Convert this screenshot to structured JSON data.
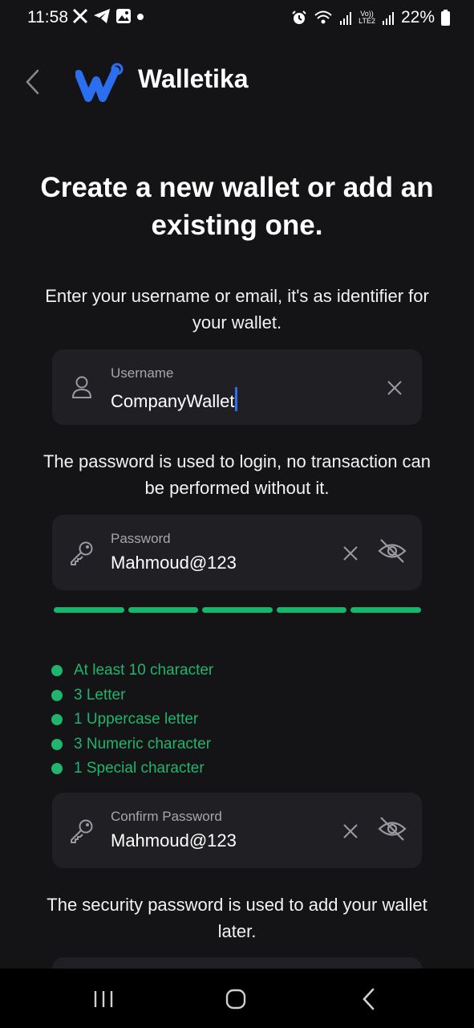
{
  "status_bar": {
    "time": "11:58",
    "net_top": "Vo))",
    "net_bottom": "LTE2",
    "battery": "22%"
  },
  "header": {
    "app_name": "Walletika",
    "brand_color": "#2b6ff0"
  },
  "title": "Create a new wallet or add an existing one.",
  "username_section": {
    "description": "Enter your username or email, it's as identifier for your wallet.",
    "label": "Username",
    "value": "CompanyWallet"
  },
  "password_section": {
    "description": "The password is used to login, no transaction can be performed without it.",
    "label": "Password",
    "value": "Mahmoud@123",
    "strength_segments_filled": 5,
    "strength_color": "#17b66a"
  },
  "password_rules": [
    {
      "text": "At least 10 character",
      "met": true
    },
    {
      "text": "3 Letter",
      "met": true
    },
    {
      "text": "1 Uppercase letter",
      "met": true
    },
    {
      "text": "3 Numeric character",
      "met": true
    },
    {
      "text": "1 Special character",
      "met": true
    }
  ],
  "confirm_section": {
    "label": "Confirm Password",
    "value": "Mahmoud@123"
  },
  "security_section": {
    "description": "The security password is used to add your wallet later."
  },
  "icons": {
    "username_field": "user-icon",
    "password_field": "key-icon",
    "clear": "close-icon",
    "visibility": "eye-off-icon"
  }
}
